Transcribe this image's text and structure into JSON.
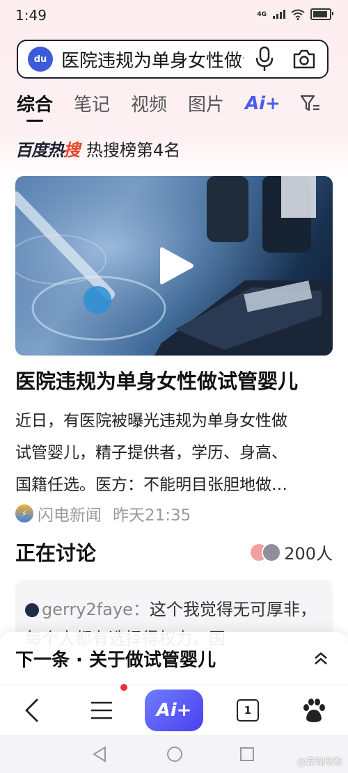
{
  "status_bar": {
    "time": "1:49",
    "network": "4G",
    "battery_level": 0.9
  },
  "search": {
    "query": "医院违规为单身女性做试管婴儿",
    "logo_text": "du"
  },
  "tabs": [
    {
      "label": "综合",
      "active": true
    },
    {
      "label": "笔记",
      "active": false
    },
    {
      "label": "视频",
      "active": false
    },
    {
      "label": "图片",
      "active": false
    }
  ],
  "tab_ai_label": "Ai+",
  "hot_rank": {
    "logo_prefix": "百度热",
    "logo_suffix": "搜",
    "text": "热搜榜第4名"
  },
  "article": {
    "title": "医院违规为单身女性做试管婴儿",
    "summary_lines": [
      "近日，有医院被曝光违规为单身女性做",
      "试管婴儿，精子提供者，学历、身高、",
      "国籍任选。医方：不能明目张胆地做…"
    ],
    "source": "闪电新闻",
    "time": "昨天21:35"
  },
  "discussion": {
    "title": "正在讨论",
    "count": "200人",
    "comment_user": "gerry2faye：",
    "comment_text": "这个我觉得无可厚非，每个人都有选择得权力，国"
  },
  "next_bar": {
    "text": "下一条 · 关于做试管婴儿"
  },
  "bottom_nav": {
    "ai_label": "Ai+",
    "tab_count": "1",
    "home_logo_text": "du"
  },
  "watermark": "@嘉瑞暗韵",
  "colors": {
    "accent": "#4a5cf0",
    "hot_red": "#e8452c",
    "notification": "#e8313d"
  }
}
